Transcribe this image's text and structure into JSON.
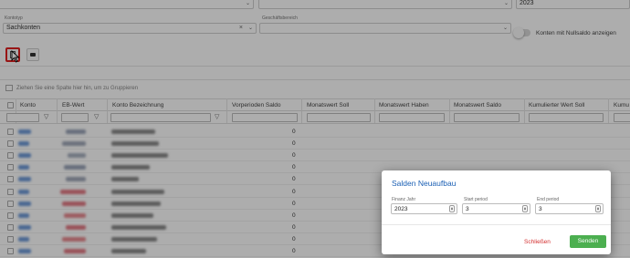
{
  "filters": {
    "year_value": "2023",
    "kontotyp_label": "Kontotyp",
    "kontotyp_value": "Sachkonten",
    "geschaeftsbereich_label": "Geschäftsbereich",
    "nullsaldo_label": "Konten mit Nullsaldo anzeigen"
  },
  "grid": {
    "group_hint": "Ziehen Sie eine Spalte hier hin, um zu Gruppieren",
    "columns": [
      "Konto",
      "EB-Wert",
      "Konto Bezeichnung",
      "Vorperioden Saldo",
      "Monatswert Soll",
      "Monatswert Haben",
      "Monatswert Saldo",
      "Kumulierter Wert Soll",
      "Kumu"
    ],
    "vorperioden_values": [
      "0",
      "0",
      "0",
      "0",
      "0",
      "0",
      "0",
      "0",
      "0",
      "0",
      "0"
    ]
  },
  "dialog": {
    "title": "Salden Neuaufbau",
    "finanz_jahr_label": "Finanz Jahr",
    "finanz_jahr_value": "2023",
    "start_period_label": "Start period",
    "start_period_value": "3",
    "end_period_label": "End period",
    "end_period_value": "3",
    "cancel_label": "Schließen",
    "send_label": "Senden"
  },
  "colors": {
    "accent_blue": "#1a5fb4",
    "send_green": "#4caf50",
    "cancel_red": "#d32f2f",
    "highlight_red": "#e02020"
  }
}
